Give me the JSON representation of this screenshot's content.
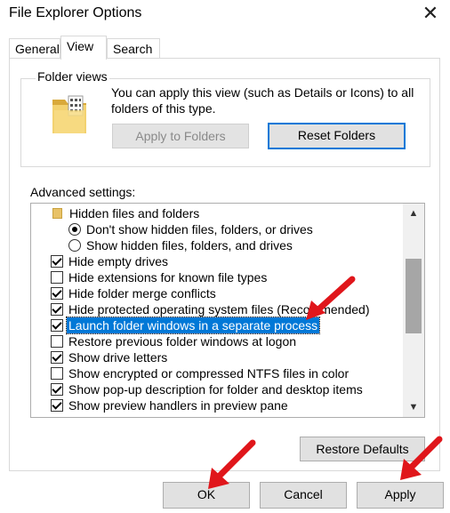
{
  "window": {
    "title": "File Explorer Options",
    "close_glyph": "✕"
  },
  "tabs": [
    {
      "label": "General",
      "active": false
    },
    {
      "label": "View",
      "active": true
    },
    {
      "label": "Search",
      "active": false
    }
  ],
  "folder_views": {
    "label": "Folder views",
    "description": "You can apply this view (such as Details or Icons) to all folders of this type.",
    "apply_button": "Apply to Folders",
    "reset_button": "Reset Folders",
    "icon": "folder-grid-icon"
  },
  "advanced": {
    "label": "Advanced settings:",
    "items": [
      {
        "type": "folder",
        "label": "Hidden files and folders"
      },
      {
        "type": "radio",
        "checked": true,
        "label": "Don't show hidden files, folders, or drives"
      },
      {
        "type": "radio",
        "checked": false,
        "label": "Show hidden files, folders, and drives"
      },
      {
        "type": "checkbox",
        "checked": true,
        "label": "Hide empty drives"
      },
      {
        "type": "checkbox",
        "checked": false,
        "label": "Hide extensions for known file types"
      },
      {
        "type": "checkbox",
        "checked": true,
        "label": "Hide folder merge conflicts"
      },
      {
        "type": "checkbox",
        "checked": true,
        "label": "Hide protected operating system files (Recommended)"
      },
      {
        "type": "checkbox",
        "checked": true,
        "label": "Launch folder windows in a separate process",
        "selected": true
      },
      {
        "type": "checkbox",
        "checked": false,
        "label": "Restore previous folder windows at logon"
      },
      {
        "type": "checkbox",
        "checked": true,
        "label": "Show drive letters"
      },
      {
        "type": "checkbox",
        "checked": false,
        "label": "Show encrypted or compressed NTFS files in color"
      },
      {
        "type": "checkbox",
        "checked": true,
        "label": "Show pop-up description for folder and desktop items"
      },
      {
        "type": "checkbox",
        "checked": true,
        "label": "Show preview handlers in preview pane"
      }
    ],
    "scroll_up_glyph": "▲",
    "scroll_down_glyph": "▼"
  },
  "restore_defaults": "Restore Defaults",
  "footer": {
    "ok": "OK",
    "cancel": "Cancel",
    "apply": "Apply"
  },
  "colors": {
    "selection": "#0078d7",
    "annotation_arrow": "#e0161b"
  }
}
